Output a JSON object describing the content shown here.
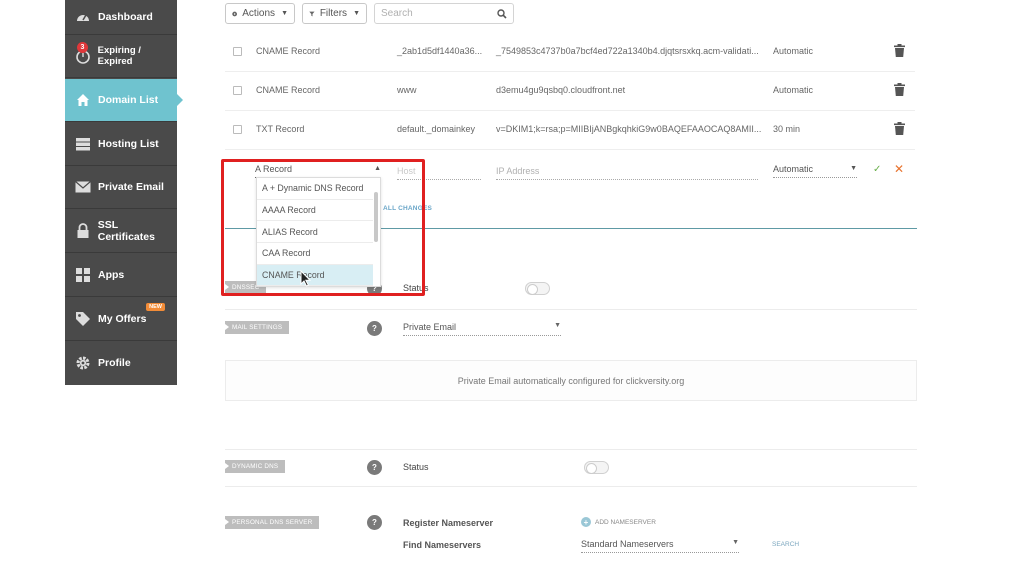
{
  "sidebar": {
    "items": [
      {
        "label": "Dashboard",
        "icon": "speedometer-icon"
      },
      {
        "label": "Expiring / Expired",
        "icon": "stopwatch-icon",
        "badge": "3"
      },
      {
        "label": "Domain List",
        "icon": "home-icon",
        "active": true
      },
      {
        "label": "Hosting List",
        "icon": "server-icon"
      },
      {
        "label": "Private Email",
        "icon": "envelope-icon"
      },
      {
        "label": "SSL Certificates",
        "icon": "lock-icon"
      },
      {
        "label": "Apps",
        "icon": "apps-icon"
      },
      {
        "label": "My Offers",
        "icon": "tag-icon",
        "badge": "NEW"
      },
      {
        "label": "Profile",
        "icon": "gear-icon"
      }
    ]
  },
  "toolbar": {
    "actions_label": "Actions",
    "filters_label": "Filters",
    "search_placeholder": "Search"
  },
  "records": [
    {
      "type": "CNAME Record",
      "host": "_2ab1d5df1440a36...",
      "value": "_7549853c4737b0a7bcf4ed722a1340b4.djqtsrsxkq.acm-validati...",
      "ttl": "Automatic"
    },
    {
      "type": "CNAME Record",
      "host": "www",
      "value": "d3emu4gu9qsbq0.cloudfront.net",
      "ttl": "Automatic"
    },
    {
      "type": "TXT Record",
      "host": "default._domainkey",
      "value": "v=DKIM1;k=rsa;p=MIIBIjANBgkqhkiG9w0BAQEFAAOCAQ8AMII...",
      "ttl": "30 min"
    }
  ],
  "edit_row": {
    "type_value": "A Record",
    "host_placeholder": "Host",
    "ip_placeholder": "IP Address",
    "ttl_value": "Automatic"
  },
  "record_type_options": [
    "A + Dynamic DNS Record",
    "AAAA Record",
    "ALIAS Record",
    "CAA Record",
    "CNAME Record"
  ],
  "hovered_option": "CNAME Record",
  "apply_link": "ALL CHANGES",
  "dnssec": {
    "tag": "DNSSEC",
    "status_label": "Status",
    "enabled": false
  },
  "mail_settings": {
    "tag": "MAIL SETTINGS",
    "value": "Private Email",
    "info": "Private Email automatically configured for clickversity.org"
  },
  "dynamic_dns": {
    "tag": "DYNAMIC DNS",
    "status_label": "Status",
    "enabled": false
  },
  "personal_dns": {
    "tag": "PERSONAL DNS SERVER",
    "register_label": "Register Nameserver",
    "add_label": "ADD NAMESERVER",
    "find_label": "Find Nameservers",
    "find_value": "Standard Nameservers",
    "search_label": "SEARCH"
  },
  "colors": {
    "sidebar": "#4a4a4a",
    "active": "#6fc3cf",
    "highlight": "#e02020",
    "cancel": "#e8732e",
    "confirm": "#6ab04c"
  }
}
